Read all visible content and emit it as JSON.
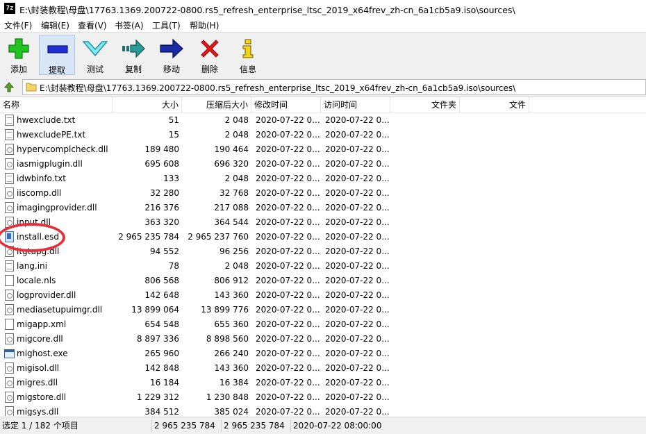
{
  "window": {
    "app_icon": "7z",
    "title": "E:\\封装教程\\母盘\\17763.1369.200722-0800.rs5_refresh_enterprise_ltsc_2019_x64frev_zh-cn_6a1cb5a9.iso\\sources\\"
  },
  "menu": [
    "文件(F)",
    "编辑(E)",
    "查看(V)",
    "书签(A)",
    "工具(T)",
    "帮助(H)"
  ],
  "toolbar": {
    "add": "添加",
    "extract": "提取",
    "test": "测试",
    "copy": "复制",
    "move": "移动",
    "delete": "删除",
    "info": "信息"
  },
  "address": {
    "path": "E:\\封装教程\\母盘\\17763.1369.200722-0800.rs5_refresh_enterprise_ltsc_2019_x64frev_zh-cn_6a1cb5a9.iso\\sources\\"
  },
  "columns": {
    "name": "名称",
    "size": "大小",
    "packed": "压缩后大小",
    "modified": "修改时间",
    "accessed": "访问时间",
    "folders": "文件夹",
    "files": "文件"
  },
  "files": [
    {
      "name": "hwexclude.txt",
      "icon": "txt",
      "size": "51",
      "packed": "2 048",
      "modified": "2020-07-22 0...",
      "accessed": "2020-07-22 0..."
    },
    {
      "name": "hwexcludePE.txt",
      "icon": "txt",
      "size": "15",
      "packed": "2 048",
      "modified": "2020-07-22 0...",
      "accessed": "2020-07-22 0..."
    },
    {
      "name": "hypervcomplcheck.dll",
      "icon": "dll",
      "size": "189 480",
      "packed": "190 464",
      "modified": "2020-07-22 0...",
      "accessed": "2020-07-22 0..."
    },
    {
      "name": "iasmigplugin.dll",
      "icon": "dll",
      "size": "695 608",
      "packed": "696 320",
      "modified": "2020-07-22 0...",
      "accessed": "2020-07-22 0..."
    },
    {
      "name": "idwbinfo.txt",
      "icon": "txt",
      "size": "133",
      "packed": "2 048",
      "modified": "2020-07-22 0...",
      "accessed": "2020-07-22 0..."
    },
    {
      "name": "iiscomp.dll",
      "icon": "dll",
      "size": "32 280",
      "packed": "32 768",
      "modified": "2020-07-22 0...",
      "accessed": "2020-07-22 0..."
    },
    {
      "name": "imagingprovider.dll",
      "icon": "dll",
      "size": "216 376",
      "packed": "217 088",
      "modified": "2020-07-22 0...",
      "accessed": "2020-07-22 0..."
    },
    {
      "name": "input.dll",
      "icon": "dll",
      "size": "363 320",
      "packed": "364 544",
      "modified": "2020-07-22 0...",
      "accessed": "2020-07-22 0..."
    },
    {
      "name": "install.esd",
      "icon": "esd",
      "size": "2 965 235 784",
      "packed": "2 965 237 760",
      "modified": "2020-07-22 0...",
      "accessed": "2020-07-22 0..."
    },
    {
      "name": "itgtupg.dll",
      "icon": "dll",
      "size": "94 552",
      "packed": "96 256",
      "modified": "2020-07-22 0...",
      "accessed": "2020-07-22 0..."
    },
    {
      "name": "lang.ini",
      "icon": "txt",
      "size": "78",
      "packed": "2 048",
      "modified": "2020-07-22 0...",
      "accessed": "2020-07-22 0..."
    },
    {
      "name": "locale.nls",
      "icon": "blank",
      "size": "806 568",
      "packed": "806 912",
      "modified": "2020-07-22 0...",
      "accessed": "2020-07-22 0..."
    },
    {
      "name": "logprovider.dll",
      "icon": "dll",
      "size": "142 648",
      "packed": "143 360",
      "modified": "2020-07-22 0...",
      "accessed": "2020-07-22 0..."
    },
    {
      "name": "mediasetupuimgr.dll",
      "icon": "dll",
      "size": "13 899 064",
      "packed": "13 899 776",
      "modified": "2020-07-22 0...",
      "accessed": "2020-07-22 0..."
    },
    {
      "name": "migapp.xml",
      "icon": "blank",
      "size": "654 548",
      "packed": "655 360",
      "modified": "2020-07-22 0...",
      "accessed": "2020-07-22 0..."
    },
    {
      "name": "migcore.dll",
      "icon": "dll",
      "size": "8 897 336",
      "packed": "8 898 560",
      "modified": "2020-07-22 0...",
      "accessed": "2020-07-22 0..."
    },
    {
      "name": "mighost.exe",
      "icon": "exe",
      "size": "265 960",
      "packed": "266 240",
      "modified": "2020-07-22 0...",
      "accessed": "2020-07-22 0..."
    },
    {
      "name": "migisol.dll",
      "icon": "dll",
      "size": "142 848",
      "packed": "143 360",
      "modified": "2020-07-22 0...",
      "accessed": "2020-07-22 0..."
    },
    {
      "name": "migres.dll",
      "icon": "dll",
      "size": "16 184",
      "packed": "16 384",
      "modified": "2020-07-22 0...",
      "accessed": "2020-07-22 0..."
    },
    {
      "name": "migstore.dll",
      "icon": "dll",
      "size": "1 229 312",
      "packed": "1 230 848",
      "modified": "2020-07-22 0...",
      "accessed": "2020-07-22 0..."
    },
    {
      "name": "migsys.dll",
      "icon": "dll",
      "size": "384 512",
      "packed": "385 024",
      "modified": "2020-07-22 0...",
      "accessed": "2020-07-22 0..."
    }
  ],
  "highlight": {
    "color": "#e8303a"
  },
  "status": {
    "selection": "选定 1 / 182 个项目",
    "size": "2 965 235 784",
    "packed": "2 965 235 784",
    "modified": "2020-07-22 08:00:00"
  }
}
